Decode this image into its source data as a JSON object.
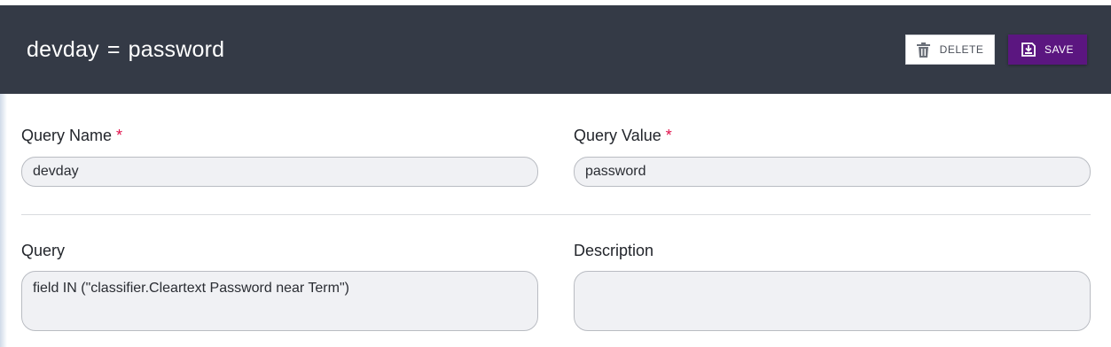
{
  "header": {
    "title_name": "devday",
    "title_operator": "=",
    "title_value": "password",
    "delete_label": "DELETE",
    "save_label": "SAVE",
    "delete_icon": "trash-icon",
    "save_icon": "save-icon"
  },
  "form": {
    "query_name": {
      "label": "Query Name",
      "required_mark": "*",
      "value": "devday"
    },
    "query_value": {
      "label": "Query Value",
      "required_mark": "*",
      "value": "password"
    },
    "query": {
      "label": "Query",
      "value": "field IN (\"classifier.Cleartext Password near Term\")"
    },
    "description": {
      "label": "Description",
      "value": ""
    }
  },
  "colors": {
    "header_bg": "#343a46",
    "save_bg": "#5b1680",
    "required": "#e0114b",
    "field_bg": "#f0f1f4"
  }
}
